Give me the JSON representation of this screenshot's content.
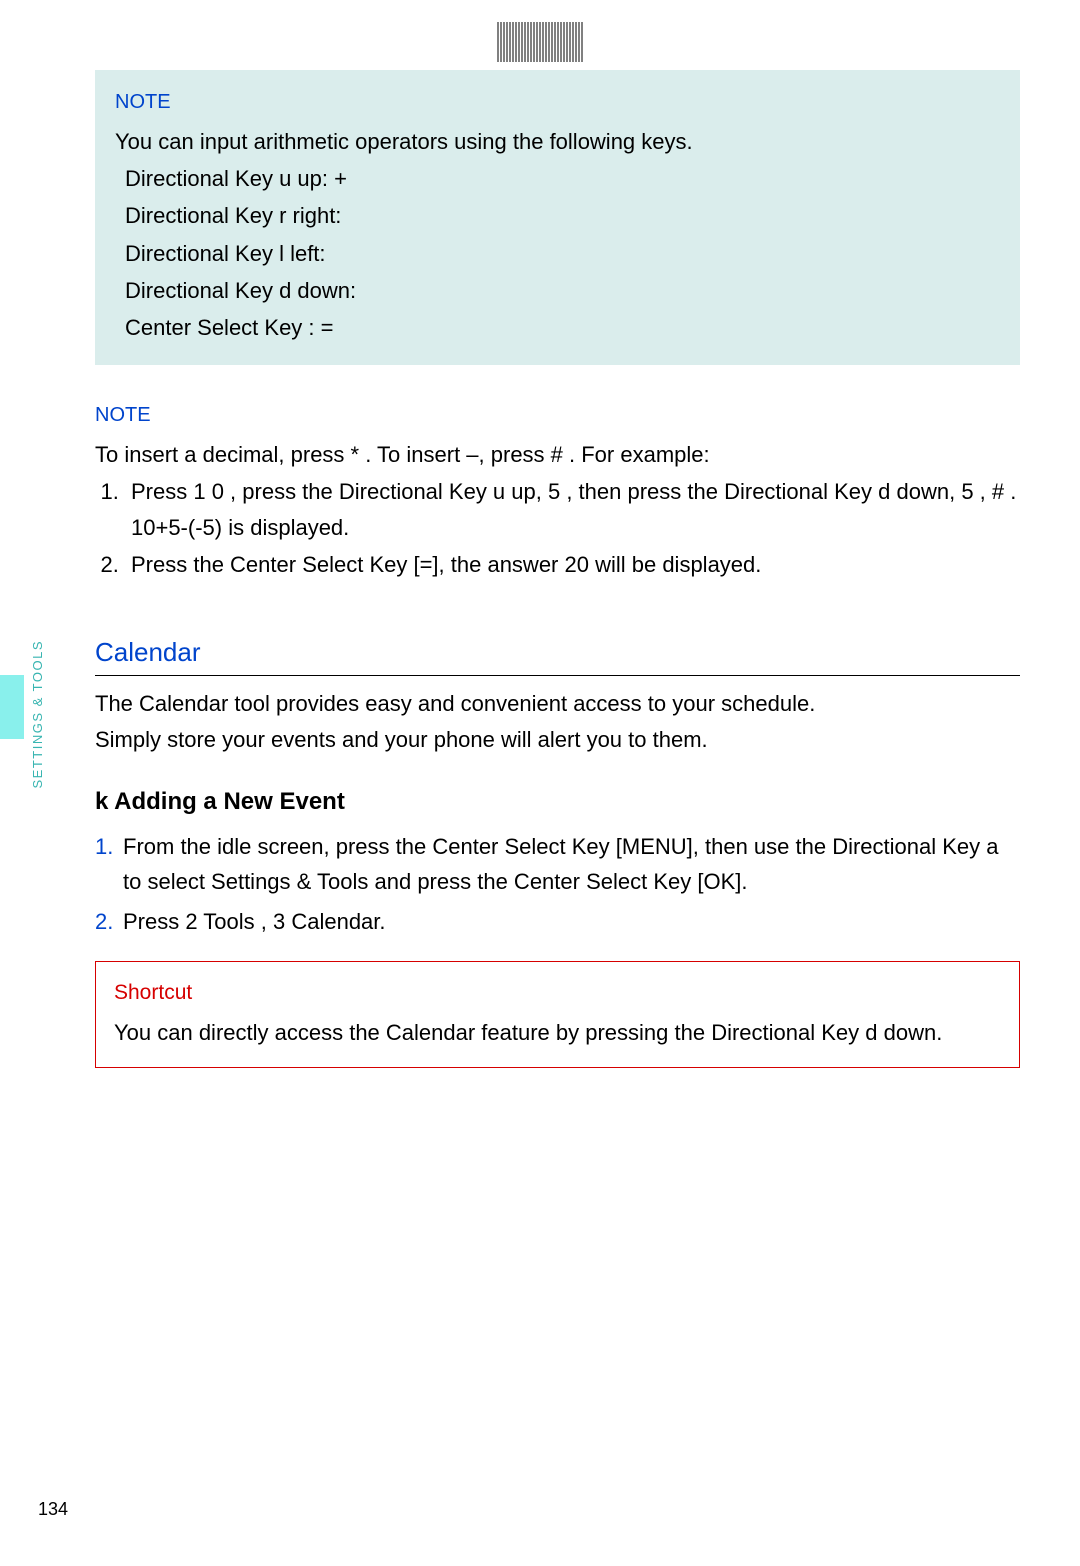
{
  "sideLabel": "SETTINGS & TOOLS",
  "pageNumber": "134",
  "note1": {
    "label": "NOTE",
    "intro": "You can input arithmetic operators using the following keys.",
    "lines": [
      "Directional Key  u     up: +",
      "Directional Key  r      right:",
      "Directional Key  l      left:",
      "Directional Key  d     down:",
      "Center Select Key : ="
    ]
  },
  "note2": {
    "label": "NOTE",
    "intro": "To insert a decimal, press  *      . To insert –, press  #      . For example:",
    "items": [
      "Press 1       0      , press the Directional Key  u     up, 5      , then press the Directional Key d     down, 5      , #      .  10+5-(-5)  is displayed.",
      "Press the Center Select Key [=], the answer  20  will be displayed."
    ]
  },
  "calendar": {
    "title": "Calendar",
    "p1": "The Calendar tool provides easy and convenient access to your schedule.",
    "p2": "Simply store your events and your phone will alert you to them.",
    "subhead": "k   Adding a New Event",
    "steps": [
      {
        "n": "1.",
        "t": "From the idle screen, press the Center Select Key [MENU], then use the Directional Key a     to select Settings & Tools and press the Center Select Key [OK]."
      },
      {
        "n": "2.",
        "t": "Press 2       Tools , 3       Calendar."
      }
    ]
  },
  "shortcut": {
    "label": "Shortcut",
    "text": "You can directly access the Calendar feature by pressing the Directional Key d     down."
  }
}
